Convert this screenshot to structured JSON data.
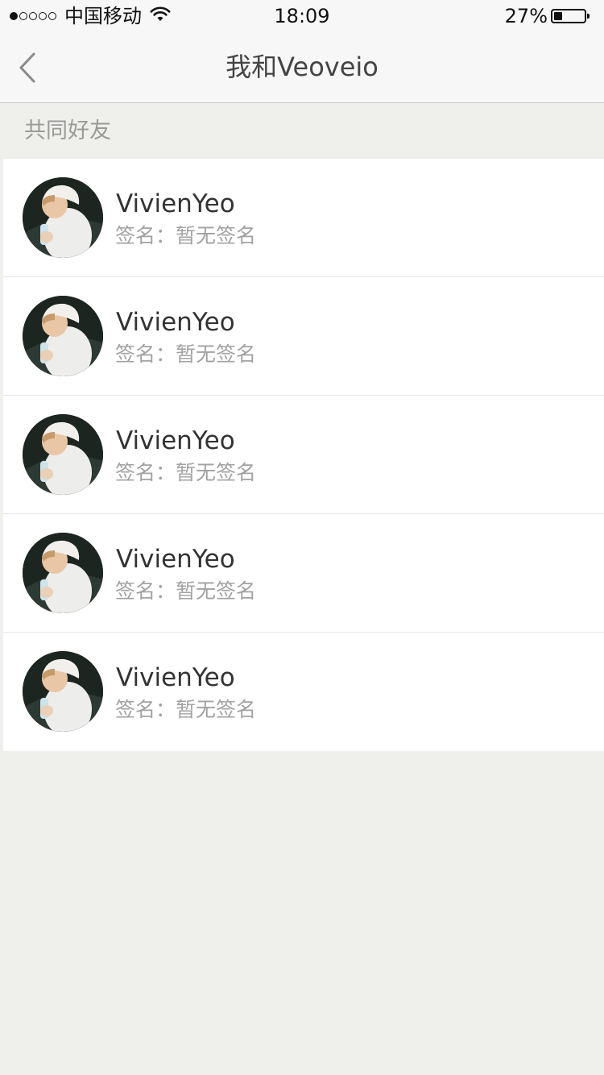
{
  "status_bar": {
    "carrier": "中国移动",
    "time": "18:09",
    "battery_percent": "27%",
    "battery_level": 0.27,
    "signal_bars_filled": 1,
    "signal_bars_total": 5
  },
  "nav": {
    "back_icon": "chevron-left-icon",
    "title": "我和Veoveio"
  },
  "section": {
    "title": "共同好友"
  },
  "friends": [
    {
      "name": "VivienYeo",
      "signature_label": "签名：",
      "signature": "暂无签名"
    },
    {
      "name": "VivienYeo",
      "signature_label": "签名：",
      "signature": "暂无签名"
    },
    {
      "name": "VivienYeo",
      "signature_label": "签名：",
      "signature": "暂无签名"
    },
    {
      "name": "VivienYeo",
      "signature_label": "签名：",
      "signature": "暂无签名"
    },
    {
      "name": "VivienYeo",
      "signature_label": "签名：",
      "signature": "暂无签名"
    }
  ],
  "colors": {
    "background": "#efefec",
    "bar": "#f7f7f7",
    "title_text": "#444444",
    "secondary_text": "#a2a2a2",
    "name_text": "#333333"
  }
}
